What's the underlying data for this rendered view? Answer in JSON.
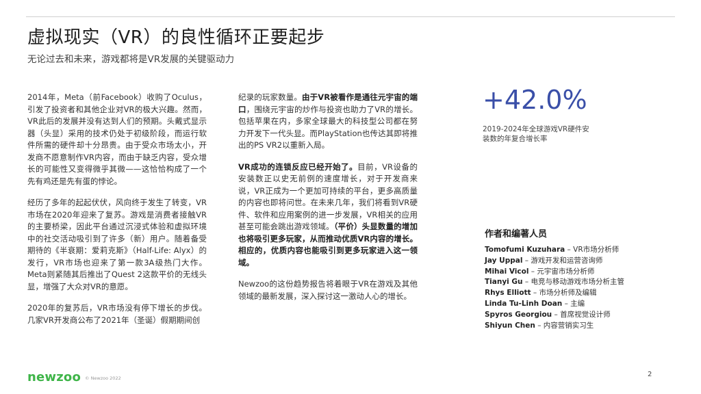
{
  "header": {
    "title": "虚拟现实（VR）的良性循环正要起步",
    "subtitle": "无论过去和未来，游戏都将是VR发展的关键驱动力"
  },
  "body": {
    "col1": {
      "p1": "2014年，Meta（前Facebook）收购了Oculus，引发了投资者和其他企业对VR的极大兴趣。然而，VR此后的发展并没有达到人们的预期。头戴式显示器（头显）采用的技术仍处于初级阶段，而运行软件所需的硬件却十分昂贵。由于受众市场太小，开发商不愿意制作VR内容，而由于缺乏内容，受众增长的可能性又变得微乎其微——这恰恰构成了一个先有鸡还是先有蛋的悖论。",
      "p2": "经历了多年的起起伏伏，风向终于发生了转变，VR市场在2020年迎来了复苏。游戏是消费者接触VR的主要桥梁，因此平台通过沉浸式体验和虚拟环境中的社交活动吸引到了许多（新）用户。随着备受期待的《半衰期：爱莉克斯》（Half-Life: Alyx）的发行，VR市场也迎来了第一款3A级热门大作。Meta则紧随其后推出了Quest 2这款平价的无线头显，增强了大众对VR的意愿。",
      "p3": "2020年的复苏后，VR市场没有停下增长的步伐。几家VR开发商公布了2021年（圣诞）假期期间创"
    },
    "col2": {
      "p1_lead": "纪录的玩家数量。",
      "p1_bold": "由于VR被看作是通往元宇宙的端口",
      "p1_rest": "，围绕元宇宙的炒作与投资也助力了VR的增长。包括苹果在内，多家全球最大的科技型公司都在努力开发下一代头显。而PlayStation也传达其即将推出的PS VR2以重新入局。",
      "p2_bold": "VR成功的连锁反应已经开始了。",
      "p2_mid": "目前，VR设备的安装数正以史无前例的速度增长，对于开发商来说，VR正成为一个更加可持续的平台，更多高质量的内容也即将问世。在未来几年，我们将看到VR硬件、软件和应用案例的进一步发展，VR相关的应用甚至可能会跳出游戏领域。",
      "p2_bold2": "（平价）头显数量的增加也将吸引更多玩家，从而推动优质VR内容的增长。相应的，优质内容也能吸引到更多玩家进入这一领域。",
      "p3": "Newzoo的这份趋势报告将着眼于VR在游戏及其他领域的最新发展，深入探讨这一激动人心的增长。"
    }
  },
  "stat": {
    "value": "+42.0%",
    "caption": "2019-2024年全球游戏VR硬件安装数的年复合增长率"
  },
  "authors": {
    "heading": "作者和编著人员",
    "list": [
      {
        "name": "Tomofumi Kuzuhara",
        "role": " – VR市场分析师"
      },
      {
        "name": "Jay Uppal",
        "role": " – 游戏开发和运营咨询师"
      },
      {
        "name": "Mihai Vicol",
        "role": " – 元宇宙市场分析师"
      },
      {
        "name": "Tianyi Gu",
        "role": " – 电竞与移动游戏市场分析主管"
      },
      {
        "name": "Rhys Elliott",
        "role": " – 市场分析师及编辑"
      },
      {
        "name": "Linda Tu-Linh Doan",
        "role": " – 主编"
      },
      {
        "name": "Spyros Georgiou",
        "role": " – 首席视觉设计师"
      },
      {
        "name": "Shiyun Chen",
        "role": " – 内容营销实习生"
      }
    ]
  },
  "footer": {
    "logo": "newzoo",
    "copyright": "© Newzoo 2022",
    "page": "2"
  },
  "colors": {
    "accent": "#3a4fa8",
    "brand": "#3fb549"
  }
}
